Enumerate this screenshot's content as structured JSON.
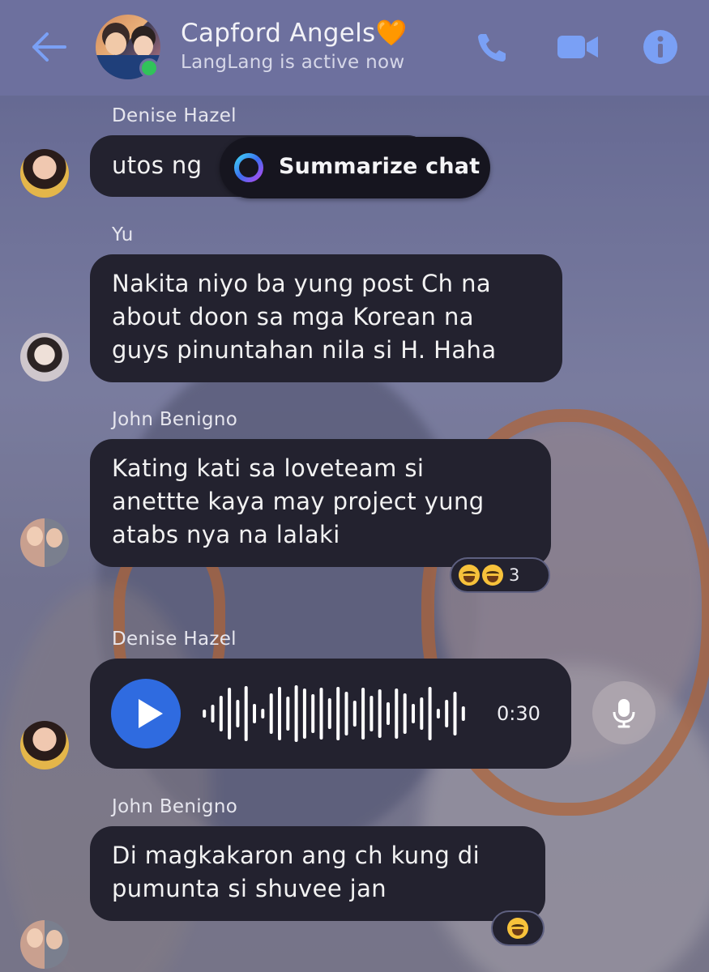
{
  "header": {
    "back_icon": "arrow-left-icon",
    "title": "Capford Angels🧡",
    "subtitle": "LangLang is active now",
    "call_icon": "phone-icon",
    "video_icon": "video-camera-icon",
    "info_icon": "info-icon",
    "accent_color": "#7aa0f5"
  },
  "summarize": {
    "label": "Summarize chat",
    "icon": "ai-ring-icon"
  },
  "messages": [
    {
      "sender": "Denise Hazel",
      "text": "utos ng"
    },
    {
      "sender": "Yu",
      "text": "Nakita niyo ba yung post Ch na\nabout doon sa mga Korean na\nguys pinuntahan nila si H. Haha"
    },
    {
      "sender": "John Benigno",
      "text": "Kating kati sa loveteam si\nanettte kaya may project yung\natabs nya na lalaki",
      "reaction_count": "3"
    },
    {
      "sender": "Denise Hazel",
      "voice": {
        "duration": "0:30",
        "play_icon": "play-icon",
        "mic_icon": "microphone-icon"
      }
    },
    {
      "sender": "John Benigno",
      "text": "Di magkakaron ang ch kung di\npumunta si shuvee jan"
    }
  ]
}
